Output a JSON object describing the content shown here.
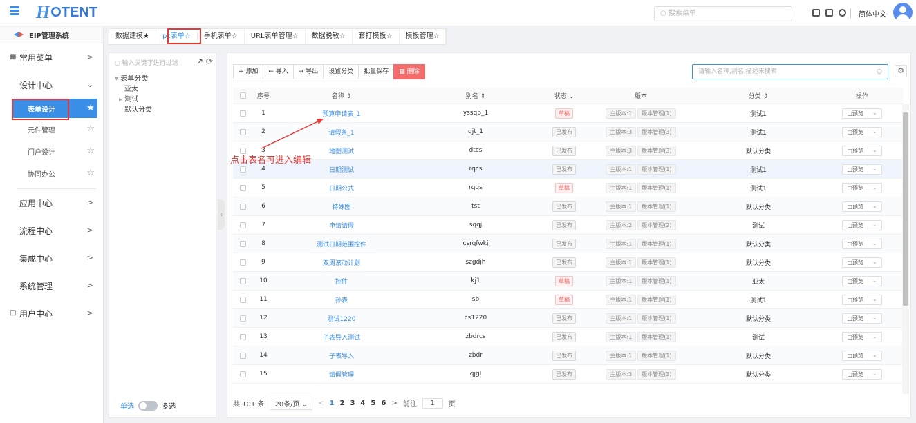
{
  "app": {
    "logo_letter": "H",
    "logo_rest": "OTENT",
    "search_placeholder": "搜索菜单",
    "language": "简体中文"
  },
  "sidebar": {
    "title": "EIP管理系统",
    "items": [
      {
        "label": "常用菜单"
      },
      {
        "label": "设计中心"
      },
      {
        "label": "表单设计"
      },
      {
        "label": "元件管理"
      },
      {
        "label": "门户设计"
      },
      {
        "label": "协同办公"
      },
      {
        "label": "应用中心"
      },
      {
        "label": "流程中心"
      },
      {
        "label": "集成中心"
      },
      {
        "label": "系统管理"
      },
      {
        "label": "用户中心"
      }
    ]
  },
  "tabs": [
    "数据建模★",
    "pc表单☆",
    "手机表单☆",
    "URL表单管理☆",
    "数据脱敏☆",
    "套打模板☆",
    "模板管理☆"
  ],
  "tree": {
    "search_placeholder": "输入关键字进行过滤",
    "root": "表单分类",
    "nodes": [
      "亚太",
      "测试",
      "默认分类"
    ],
    "single": "单选",
    "multi": "多选"
  },
  "toolbar": {
    "add": "+ 添加",
    "import": "← 导入",
    "export": "→ 导出",
    "set_category": "设置分类",
    "batch_save": "批量保存",
    "delete": "删除"
  },
  "main_search_placeholder": "请输入名称,别名,描述来搜索",
  "columns": {
    "no": "序号",
    "name": "名称 ⇕",
    "alias": "别名 ⇕",
    "status": "状态 ⌄",
    "version": "版本",
    "category": "分类 ⇕",
    "op": "操作"
  },
  "rows": [
    {
      "no": "1",
      "name": "预算申请表_1",
      "alias": "yssqb_1",
      "status": "草稿",
      "ver": "主版本:1",
      "mgr": "版本管理(1)",
      "cat": "测试1",
      "op": "预览"
    },
    {
      "no": "2",
      "name": "请假条_1",
      "alias": "qjt_1",
      "status": "已发布",
      "ver": "主版本:3",
      "mgr": "版本管理(3)",
      "cat": "测试1",
      "op": "预览"
    },
    {
      "no": "3",
      "name": "地图测试",
      "alias": "dtcs",
      "status": "已发布",
      "ver": "主版本:3",
      "mgr": "版本管理(3)",
      "cat": "默认分类",
      "op": "预览"
    },
    {
      "no": "4",
      "name": "日期测试",
      "alias": "rqcs",
      "status": "已发布",
      "ver": "主版本:1",
      "mgr": "版本管理(1)",
      "cat": "测试1",
      "op": "预览"
    },
    {
      "no": "5",
      "name": "日期公式",
      "alias": "rqgs",
      "status": "草稿",
      "ver": "主版本:1",
      "mgr": "版本管理(1)",
      "cat": "测试1",
      "op": "预览"
    },
    {
      "no": "6",
      "name": "特殊图",
      "alias": "tst",
      "status": "已发布",
      "ver": "主版本:1",
      "mgr": "版本管理(1)",
      "cat": "默认分类",
      "op": "预览"
    },
    {
      "no": "7",
      "name": "申请请假",
      "alias": "sqqj",
      "status": "已发布",
      "ver": "主版本:2",
      "mgr": "版本管理(2)",
      "cat": "测试",
      "op": "预览"
    },
    {
      "no": "8",
      "name": "测试日期范围控件",
      "alias": "csrqfwkj",
      "status": "已发布",
      "ver": "主版本:1",
      "mgr": "版本管理(1)",
      "cat": "默认分类",
      "op": "预览"
    },
    {
      "no": "9",
      "name": "双周滚动计划",
      "alias": "szgdjh",
      "status": "已发布",
      "ver": "主版本:1",
      "mgr": "版本管理(1)",
      "cat": "默认分类",
      "op": "预览"
    },
    {
      "no": "10",
      "name": "控件",
      "alias": "kj1",
      "status": "草稿",
      "ver": "主版本:1",
      "mgr": "版本管理(1)",
      "cat": "亚太",
      "op": "预览"
    },
    {
      "no": "11",
      "name": "孙表",
      "alias": "sb",
      "status": "草稿",
      "ver": "主版本:1",
      "mgr": "版本管理(1)",
      "cat": "测试1",
      "op": "预览"
    },
    {
      "no": "12",
      "name": "测试1220",
      "alias": "cs1220",
      "status": "已发布",
      "ver": "主版本:1",
      "mgr": "版本管理(1)",
      "cat": "默认分类",
      "op": "预览"
    },
    {
      "no": "13",
      "name": "子表导入测试",
      "alias": "zbdrcs",
      "status": "已发布",
      "ver": "主版本:1",
      "mgr": "版本管理(1)",
      "cat": "测试",
      "op": "预览"
    },
    {
      "no": "14",
      "name": "子表导入",
      "alias": "zbdr",
      "status": "已发布",
      "ver": "主版本:1",
      "mgr": "版本管理(1)",
      "cat": "默认分类",
      "op": "预览"
    },
    {
      "no": "15",
      "name": "请假管理",
      "alias": "qjgl",
      "status": "已发布",
      "ver": "主版本:3",
      "mgr": "版本管理(3)",
      "cat": "默认分类",
      "op": "预览"
    }
  ],
  "pager": {
    "total": "共 101 条",
    "size": "20条/页",
    "pages": [
      "1",
      "2",
      "3",
      "4",
      "5",
      "6"
    ],
    "goto": "前往",
    "page_value": "1",
    "page_unit": "页"
  },
  "annotation": "点击表名可进入编辑",
  "colors": {
    "accent": "#3a8ee6",
    "danger": "#f56c6c",
    "highlight": "#e53935"
  }
}
